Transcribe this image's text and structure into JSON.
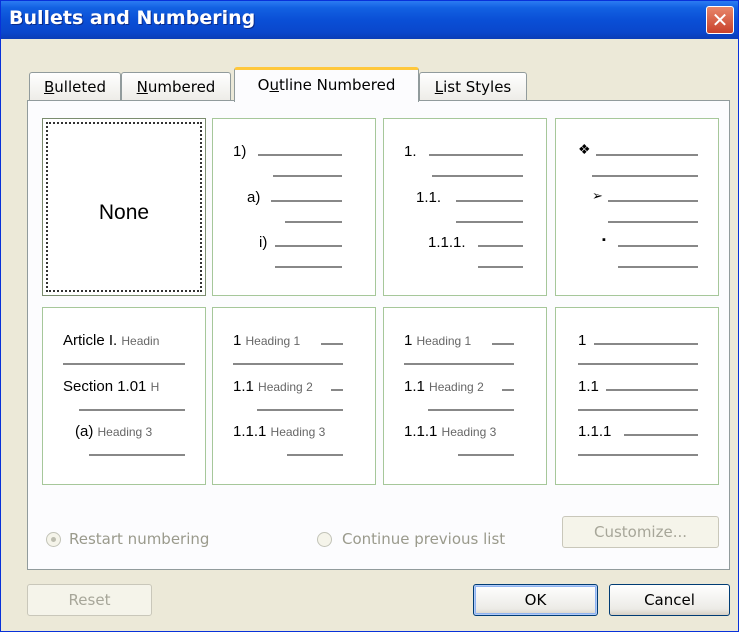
{
  "window": {
    "title": "Bullets and Numbering",
    "close_label": "✕"
  },
  "tabs": [
    {
      "label": "Bulleted",
      "accel": "B",
      "rest": "ulleted"
    },
    {
      "label": "Numbered",
      "accel": "N",
      "rest": "umbered"
    },
    {
      "label": "Outline Numbered",
      "pre": "O",
      "accel": "u",
      "rest": "tline Numbered"
    },
    {
      "label": "List Styles",
      "accel": "L",
      "rest": "ist Styles"
    }
  ],
  "gallery": {
    "none_label": "None",
    "cell2": [
      "1)",
      "a)",
      "i)"
    ],
    "cell3": [
      "1.",
      "1.1.",
      "1.1.1."
    ],
    "cell4": [
      "❖",
      "➢",
      "▪"
    ],
    "cell5": [
      {
        "num": "Article I.",
        "text": "Headin"
      },
      {
        "num": "Section 1.01",
        "text": "H"
      },
      {
        "num": "(a)",
        "text": "Heading 3"
      }
    ],
    "cell6": [
      {
        "num": "1",
        "text": "Heading 1"
      },
      {
        "num": "1.1",
        "text": "Heading 2"
      },
      {
        "num": "1.1.1",
        "text": "Heading 3"
      }
    ],
    "cell7": [
      {
        "num": "1",
        "text": "Heading 1"
      },
      {
        "num": "1.1",
        "text": "Heading 2"
      },
      {
        "num": "1.1.1",
        "text": "Heading 3"
      }
    ],
    "cell8": [
      "1",
      "1.1",
      "1.1.1"
    ]
  },
  "options": {
    "restart_label": "Restart numbering",
    "continue_label": "Continue previous list",
    "customize_label": "Customize..."
  },
  "buttons": {
    "reset": "Reset",
    "ok": "OK",
    "cancel": "Cancel"
  }
}
